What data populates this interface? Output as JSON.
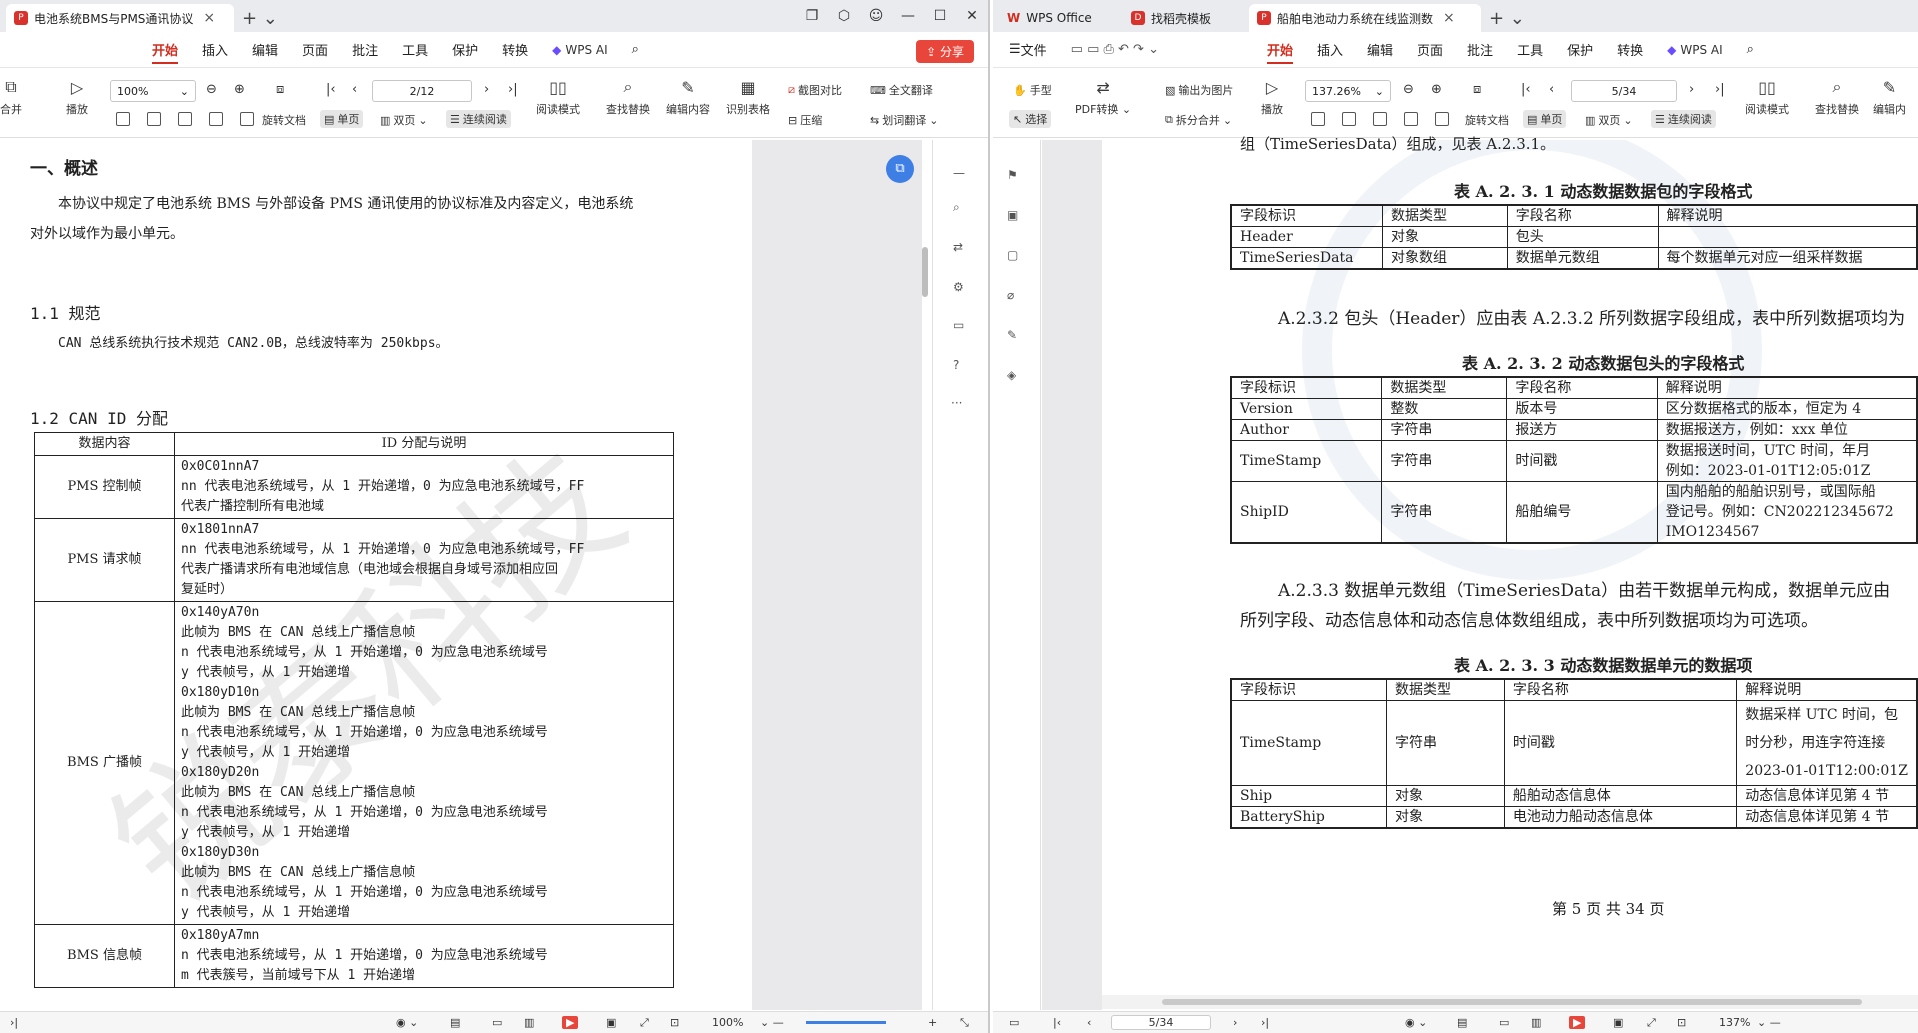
{
  "left": {
    "tab_title": "电池系统BMS与PMS通讯协议",
    "menus": [
      "开始",
      "插入",
      "编辑",
      "页面",
      "批注",
      "工具",
      "保护",
      "转换"
    ],
    "wps_ai": "WPS AI",
    "share": "分享",
    "toolbar": {
      "merge": "合并",
      "play": "播放",
      "zoom": "100%",
      "rotate": "旋转文档",
      "single": "单页",
      "double": "双页",
      "continuous": "连续阅读",
      "read_mode": "阅读模式",
      "find_replace": "查找替换",
      "edit": "编辑内容",
      "recognize": "识别表格",
      "screenshot_compare": "截图对比",
      "compress": "压缩",
      "full_translate": "全文翻译",
      "word_translate": "划词翻译",
      "page": "2/12"
    },
    "doc": {
      "h1": "一、概述",
      "p1a": "本协议中规定了电池系统 BMS 与外部设备 PMS 通讯使用的协议标准及内容定义，电池系统",
      "p1b": "对外以域作为最小单元。",
      "h11": "1.1 规范",
      "p11": "CAN 总线系统执行技术规范 CAN2.0B，总线波特率为 250kbps。",
      "h12": "1.2 CAN ID 分配",
      "th1": "数据内容",
      "th2": "ID 分配与说明",
      "rows": [
        {
          "name": "PMS 控制帧",
          "lines": [
            "0x0C01nnA7",
            "nn 代表电池系统域号，从 1 开始递增，0 为应急电池系统域号，FF",
            "代表广播控制所有电池域"
          ]
        },
        {
          "name": "PMS 请求帧",
          "lines": [
            "0x1801nnA7",
            "nn 代表电池系统域号，从 1 开始递增，0 为应急电池系统域号，FF",
            "代表广播请求所有电池域信息（电池域会根据自身域号添加相应回",
            "复延时）"
          ]
        },
        {
          "name": "BMS 广播帧",
          "lines": [
            "0x140yA70n",
            "此帧为 BMS 在 CAN 总线上广播信息帧",
            "n 代表电池系统域号，从 1 开始递增，0 为应急电池系统域号",
            "y 代表帧号，从 1 开始递增",
            "0x180yD10n",
            "此帧为 BMS 在 CAN 总线上广播信息帧",
            "n 代表电池系统域号，从 1 开始递增，0 为应急电池系统域号",
            "y 代表帧号，从 1 开始递增",
            "0x180yD20n",
            "此帧为 BMS 在 CAN 总线上广播信息帧",
            "n 代表电池系统域号，从 1 开始递增，0 为应急电池系统域号",
            "y 代表帧号，从 1 开始递增",
            "0x180yD30n",
            "此帧为 BMS 在 CAN 总线上广播信息帧",
            "n 代表电池系统域号，从 1 开始递增，0 为应急电池系统域号",
            "y 代表帧号，从 1 开始递增"
          ]
        },
        {
          "name": "BMS 信息帧",
          "lines": [
            "0x180yA7mn",
            "n 代表电池系统域号，从 1 开始递增，0 为应急电池系统域号",
            "m 代表簇号，当前域号下从 1 开始递增"
          ]
        }
      ]
    },
    "status": {
      "zoom": "100%"
    }
  },
  "right": {
    "tab_wps": "WPS Office",
    "tab_find": "找稻壳模板",
    "tab_title": "船舶电池动力系统在线监测数",
    "file_menu": "文件",
    "menus": [
      "开始",
      "插入",
      "编辑",
      "页面",
      "批注",
      "工具",
      "保护",
      "转换"
    ],
    "wps_ai": "WPS AI",
    "toolbar": {
      "hand": "手型",
      "select": "选择",
      "pdf_convert": "PDF转换",
      "export_img": "输出为图片",
      "split_merge": "拆分合并",
      "play": "播放",
      "zoom": "137.26%",
      "page": "5/34",
      "rotate": "旋转文档",
      "single": "单页",
      "double": "双页",
      "continuous": "连续阅读",
      "read_mode": "阅读模式",
      "find_replace": "查找替换",
      "edit": "编辑内"
    },
    "doc": {
      "top_fragment": "组（TimeSeriesData）组成，见表 A.2.3.1。",
      "cap1": "表 A. 2. 3. 1  动态数据数据包的字段格式",
      "t1": {
        "head": [
          "字段标识",
          "数据类型",
          "字段名称",
          "解释说明"
        ],
        "rows": [
          [
            "Header",
            "对象",
            "包头",
            ""
          ],
          [
            "TimeSeriesData",
            "对象数组",
            "数据单元数组",
            "每个数据单元对应一组采样数据"
          ]
        ]
      },
      "p232": "A.2.3.2  包头（Header）应由表 A.2.3.2 所列数据字段组成，表中所列数据项均为",
      "cap2": "表 A. 2. 3. 2  动态数据包头的字段格式",
      "t2": {
        "head": [
          "字段标识",
          "数据类型",
          "字段名称",
          "解释说明"
        ],
        "rows": [
          [
            "Version",
            "整数",
            "版本号",
            "区分数据格式的版本，恒定为 4"
          ],
          [
            "Author",
            "字符串",
            "报送方",
            "数据报送方，例如：xxx 单位"
          ],
          [
            "TimeStamp",
            "字符串",
            "时间戳",
            "数据报送时间，UTC 时间，年月|例如：2023-01-01T12:05:01Z"
          ],
          [
            "ShipID",
            "字符串",
            "船舶编号",
            "国内船舶的船舶识别号，或国际船|登记号。例如：CN202212345672|IMO1234567"
          ]
        ]
      },
      "p233a": "A.2.3.3  数据单元数组（TimeSeriesData）由若干数据单元构成，数据单元应由",
      "p233b": "所列字段、动态信息体和动态信息体数组组成，表中所列数据项均为可选项。",
      "cap3": "表 A. 2. 3. 3  动态数据数据单元的数据项",
      "t3": {
        "head": [
          "字段标识",
          "数据类型",
          "字段名称",
          "解释说明"
        ],
        "rows": [
          [
            "TimeStamp",
            "字符串",
            "时间戳",
            "数据采样 UTC 时间，包|时分秒，用连字符连接|2023-01-01T12:00:01Z"
          ],
          [
            "Ship",
            "对象",
            "船舶动态信息体",
            "动态信息体详见第 4 节"
          ],
          [
            "BatteryShip",
            "对象",
            "电池动力船动态信息体",
            "动态信息体详见第 4 节"
          ]
        ]
      },
      "footer": "第  5  页  共  34  页"
    },
    "status": {
      "page": "5/34",
      "zoom": "137%"
    }
  },
  "watermark": "锐泰科技"
}
